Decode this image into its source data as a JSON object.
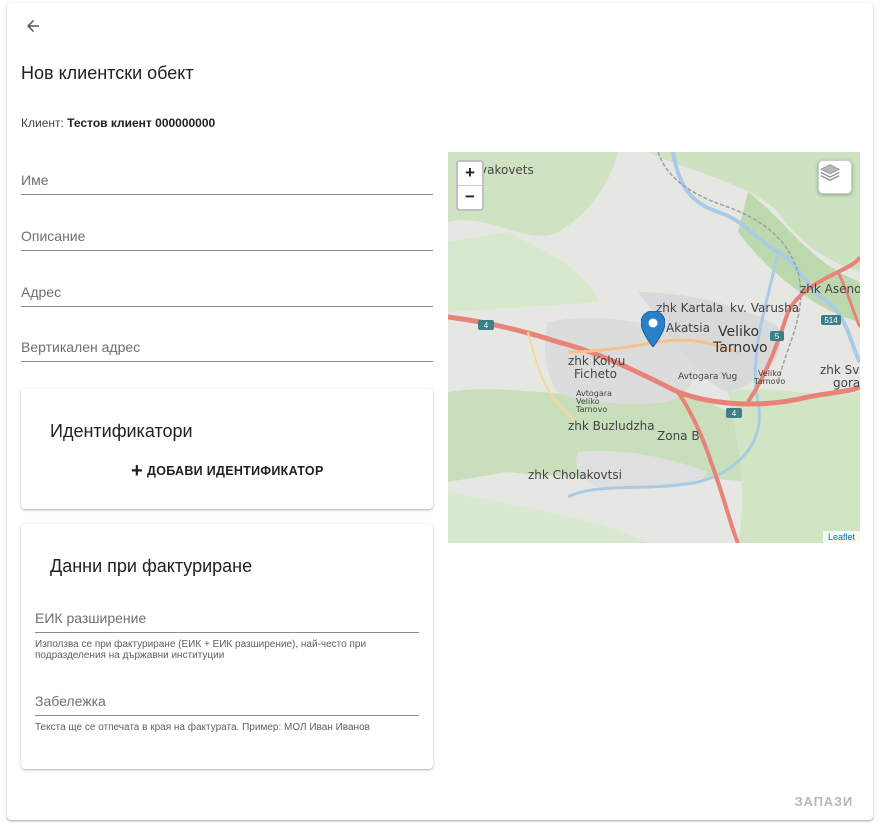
{
  "page": {
    "title": "Нов клиентски обект",
    "client_label": "Клиент:",
    "client_value": "Тестов клиент 000000000"
  },
  "form": {
    "name_placeholder": "Име",
    "description_placeholder": "Описание",
    "address_placeholder": "Адрес",
    "vertical_address_placeholder": "Вертикален адрес"
  },
  "identifiers": {
    "title": "Идентификатори",
    "add_label": "ДОБАВИ ИДЕНТИФИКАТОР"
  },
  "billing": {
    "title": "Данни при фактуриране",
    "eik_placeholder": "ЕИК разширение",
    "eik_hint": "Използва се при фактуриране (ЕИК + ЕИК разширение), най-често при подразделения на държавни институции",
    "note_placeholder": "Забележка",
    "note_hint": "Текста ще се отпечата в края на фактурата. Пример: МОЛ Иван Иванов"
  },
  "map": {
    "zoom_in": "+",
    "zoom_out": "−",
    "attribution": "Leaflet",
    "labels": {
      "lyakovets": "yakovets",
      "kartala": "zhk Kartala",
      "varusha": "kv. Varusha",
      "aseno": "zhk Aseno",
      "akatsia": "Akatsia",
      "veliko": "Veliko",
      "tarnovo": "Tarnovo",
      "kolyu": "zhk Kolyu",
      "ficheto": "Ficheto",
      "avtogara_yug": "Avtogara Yug",
      "vt_st_1": "Veliko",
      "vt_st_2": "Tarnovo",
      "avtogara": "Avtogara",
      "av_veliko": "Veliko",
      "av_tarnovo": "Tarnovo",
      "sveta": "zhk Sve",
      "gora": "gora",
      "buzludzha": "zhk Buzludzha",
      "zona_b": "Zona B",
      "cholakovtsi": "zhk Cholakovtsi",
      "road_4a": "4",
      "road_4b": "4",
      "road_5": "5",
      "road_514": "514"
    }
  },
  "actions": {
    "save": "ЗАПАЗИ"
  },
  "colors": {
    "marker": "#2a81cb",
    "save_disabled": "#b8b8b8",
    "road": "#e8837a"
  }
}
